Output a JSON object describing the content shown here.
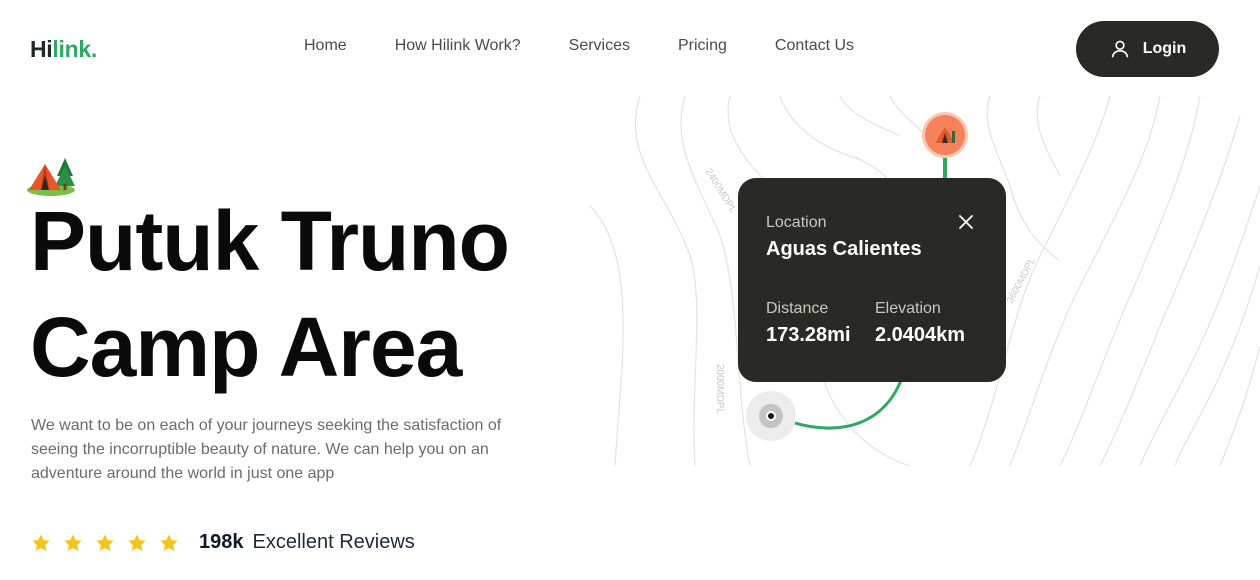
{
  "brand": {
    "hi": "Hi",
    "link": "link.",
    "accent": "#2fa862"
  },
  "nav": {
    "links": [
      "Home",
      "How Hilink Work?",
      "Services",
      "Pricing",
      "Contact Us"
    ],
    "login_label": "Login",
    "login_icon": "user-icon"
  },
  "hero": {
    "title_line1": "Putuk Truno",
    "title_line2": "Camp Area",
    "icon": "camping-tent-icon",
    "description": "We want to be on each of your journeys seeking the satisfaction of seeing the incorruptible beauty of nature. We can help you on an adventure around the world in just one app",
    "rating_stars": 5,
    "reviews_count": "198k",
    "reviews_label": "Excellent Reviews",
    "star_color": "#f5c518"
  },
  "map": {
    "contour_labels": [
      "2400MDPL",
      "3600MDPL",
      "2000MDPL"
    ],
    "route_color": "#2fa862",
    "pin_color": "#f5825a"
  },
  "card": {
    "location_label": "Location",
    "location_value": "Aguas Calientes",
    "distance_label": "Distance",
    "distance_value": "173.28mi",
    "elevation_label": "Elevation",
    "elevation_value": "2.0404km",
    "background": "#292a26"
  }
}
